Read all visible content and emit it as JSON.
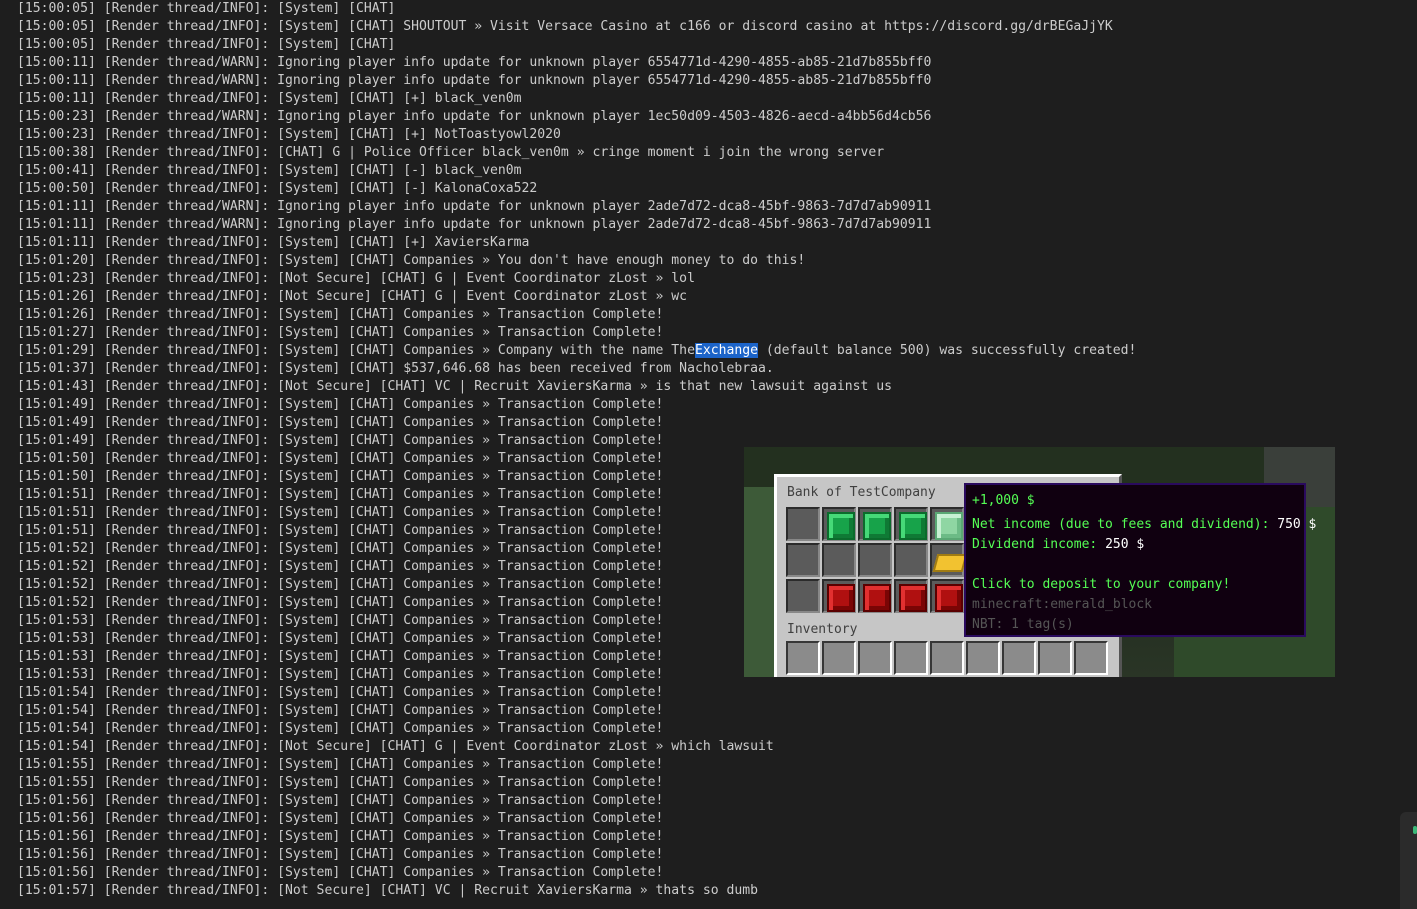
{
  "log_lines": [
    "[15:00:05] [Render thread/INFO]: [System] [CHAT]",
    "[15:00:05] [Render thread/INFO]: [System] [CHAT] SHOUTOUT » Visit Versace Casino at c166 or discord casino at https://discord.gg/drBEGaJjYK",
    "[15:00:05] [Render thread/INFO]: [System] [CHAT]",
    "[15:00:11] [Render thread/WARN]: Ignoring player info update for unknown player 6554771d-4290-4855-ab85-21d7b855bff0",
    "[15:00:11] [Render thread/WARN]: Ignoring player info update for unknown player 6554771d-4290-4855-ab85-21d7b855bff0",
    "[15:00:11] [Render thread/INFO]: [System] [CHAT] [+] black_ven0m",
    "[15:00:23] [Render thread/WARN]: Ignoring player info update for unknown player 1ec50d09-4503-4826-aecd-a4bb56d4cb56",
    "[15:00:23] [Render thread/INFO]: [System] [CHAT] [+] NotToastyowl2020",
    "[15:00:38] [Render thread/INFO]: [CHAT] G | Police Officer black_ven0m » cringe moment i join the wrong server",
    "[15:00:41] [Render thread/INFO]: [System] [CHAT] [-] black_ven0m",
    "[15:00:50] [Render thread/INFO]: [System] [CHAT] [-] KalonaCoxa522",
    "[15:01:11] [Render thread/WARN]: Ignoring player info update for unknown player 2ade7d72-dca8-45bf-9863-7d7d7ab90911",
    "[15:01:11] [Render thread/WARN]: Ignoring player info update for unknown player 2ade7d72-dca8-45bf-9863-7d7d7ab90911",
    "[15:01:11] [Render thread/INFO]: [System] [CHAT] [+] XaviersKarma",
    "[15:01:20] [Render thread/INFO]: [System] [CHAT] Companies » You don't have enough money to do this!",
    "[15:01:23] [Render thread/INFO]: [Not Secure] [CHAT] G | Event Coordinator zLost » lol",
    "[15:01:26] [Render thread/INFO]: [Not Secure] [CHAT] G | Event Coordinator zLost » wc",
    "[15:01:26] [Render thread/INFO]: [System] [CHAT] Companies » Transaction Complete!",
    "[15:01:27] [Render thread/INFO]: [System] [CHAT] Companies » Transaction Complete!",
    "[15:01:29] [Render thread/INFO]: [System] [CHAT] Companies » Company with the name The",
    "[15:01:37] [Render thread/INFO]: [System] [CHAT] $537,646.68 has been received from Nacholebraa.",
    "[15:01:43] [Render thread/INFO]: [Not Secure] [CHAT] VC | Recruit XaviersKarma » is that new lawsuit against us",
    "[15:01:49] [Render thread/INFO]: [System] [CHAT] Companies » Transaction Complete!",
    "[15:01:49] [Render thread/INFO]: [System] [CHAT] Companies » Transaction Complete!",
    "[15:01:49] [Render thread/INFO]: [System] [CHAT] Companies » Transaction Complete!",
    "[15:01:50] [Render thread/INFO]: [System] [CHAT] Companies » Transaction Complete!",
    "[15:01:50] [Render thread/INFO]: [System] [CHAT] Companies » Transaction Complete!",
    "[15:01:51] [Render thread/INFO]: [System] [CHAT] Companies » Transaction Complete!",
    "[15:01:51] [Render thread/INFO]: [System] [CHAT] Companies » Transaction Complete!",
    "[15:01:51] [Render thread/INFO]: [System] [CHAT] Companies » Transaction Complete!",
    "[15:01:52] [Render thread/INFO]: [System] [CHAT] Companies » Transaction Complete!",
    "[15:01:52] [Render thread/INFO]: [System] [CHAT] Companies » Transaction Complete!",
    "[15:01:52] [Render thread/INFO]: [System] [CHAT] Companies » Transaction Complete!",
    "[15:01:52] [Render thread/INFO]: [System] [CHAT] Companies » Transaction Complete!",
    "[15:01:53] [Render thread/INFO]: [System] [CHAT] Companies » Transaction Complete!",
    "[15:01:53] [Render thread/INFO]: [System] [CHAT] Companies » Transaction Complete!",
    "[15:01:53] [Render thread/INFO]: [System] [CHAT] Companies » Transaction Complete!",
    "[15:01:53] [Render thread/INFO]: [System] [CHAT] Companies » Transaction Complete!",
    "[15:01:54] [Render thread/INFO]: [System] [CHAT] Companies » Transaction Complete!",
    "[15:01:54] [Render thread/INFO]: [System] [CHAT] Companies » Transaction Complete!",
    "[15:01:54] [Render thread/INFO]: [System] [CHAT] Companies » Transaction Complete!",
    "[15:01:54] [Render thread/INFO]: [Not Secure] [CHAT] G | Event Coordinator zLost » which lawsuit",
    "[15:01:55] [Render thread/INFO]: [System] [CHAT] Companies » Transaction Complete!",
    "[15:01:55] [Render thread/INFO]: [System] [CHAT] Companies » Transaction Complete!",
    "[15:01:56] [Render thread/INFO]: [System] [CHAT] Companies » Transaction Complete!",
    "[15:01:56] [Render thread/INFO]: [System] [CHAT] Companies » Transaction Complete!",
    "[15:01:56] [Render thread/INFO]: [System] [CHAT] Companies » Transaction Complete!",
    "[15:01:56] [Render thread/INFO]: [System] [CHAT] Companies » Transaction Complete!",
    "[15:01:56] [Render thread/INFO]: [System] [CHAT] Companies » Transaction Complete!",
    "[15:01:57] [Render thread/INFO]: [Not Secure] [CHAT] VC | Recruit XaviersKarma » thats so dumb"
  ],
  "selection": {
    "line_index": 19,
    "selected_text": "Exchange",
    "after_text": " (default balance 500) was successfully created!"
  },
  "game": {
    "container_title": "Bank of TestCompany",
    "inventory_label": "Inventory",
    "tooltip": {
      "title": "+1,000 $",
      "net_income_label": "Net income (due to fees and dividend):",
      "net_income_value": "750 $",
      "dividend_label": "Dividend income:",
      "dividend_value": "250 $",
      "action": "Click to deposit to your company!",
      "item_id": "minecraft:emerald_block",
      "nbt": "NBT: 1 tag(s)"
    },
    "slots_row1": [
      "glass-pane-icon",
      "emerald-block-icon",
      "emerald-block-icon",
      "emerald-block-icon",
      "emerald-block-icon"
    ],
    "slots_row2": [
      "glass-pane-icon",
      "glass-pane-icon",
      "glass-pane-icon",
      "glass-pane-icon",
      "gold-ingot-icon"
    ],
    "slots_row3": [
      "glass-pane-icon",
      "redstone-block-icon",
      "redstone-block-icon",
      "redstone-block-icon",
      "redstone-block-icon"
    ]
  },
  "colors": {
    "background": "#1e1e1e",
    "text": "#cccccc",
    "selection": "#1c64c9",
    "tooltip_green": "#55ff55"
  }
}
